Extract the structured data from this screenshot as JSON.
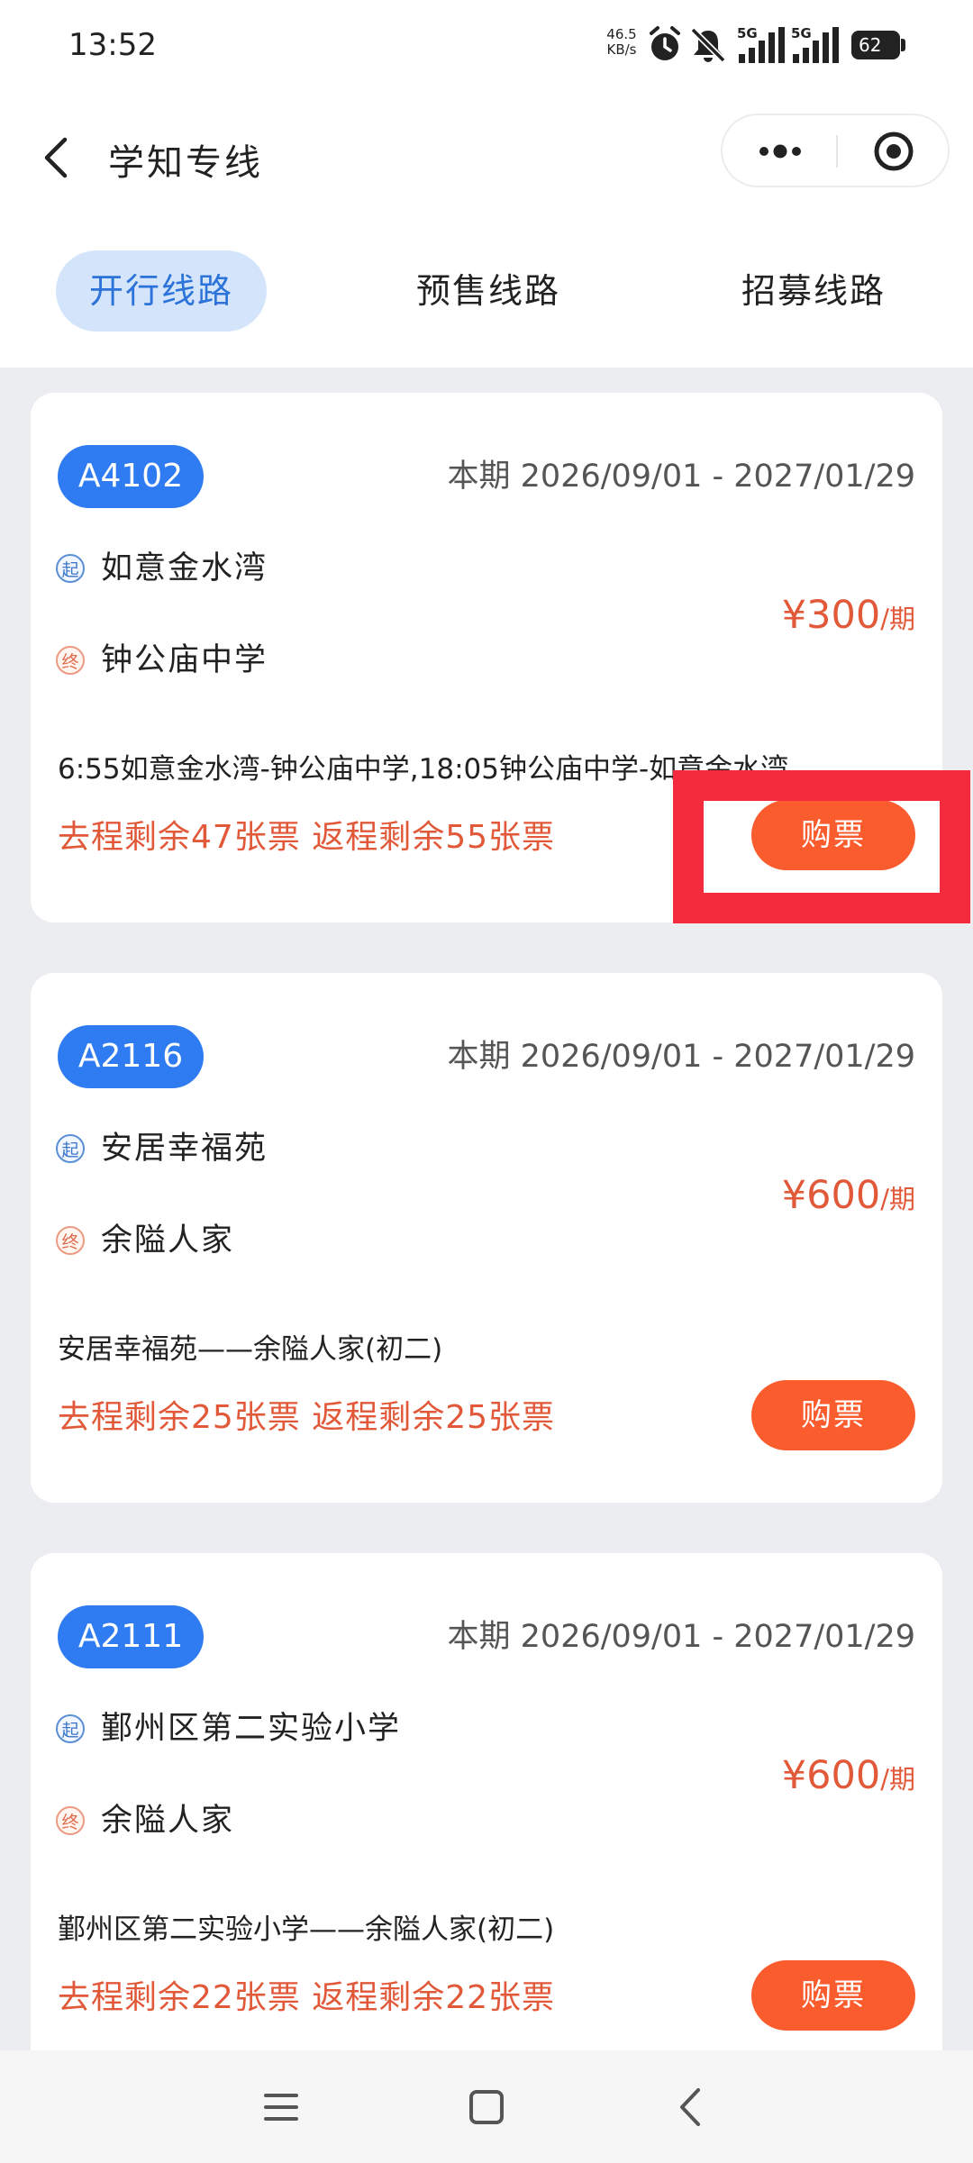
{
  "status_bar": {
    "time": "13:52",
    "net_speed_value": "46.5",
    "net_speed_unit": "KB/s",
    "signal_1_label": "5G",
    "signal_2_label": "5G",
    "battery": "62",
    "icons": [
      "alarm-icon",
      "mute-vibrate-icon",
      "signal-icon",
      "signal-icon",
      "battery-icon"
    ]
  },
  "nav": {
    "title": "学知专线",
    "icons": [
      "back-arrow-icon",
      "more-icon",
      "target-icon"
    ]
  },
  "tabs": [
    {
      "label": "开行线路",
      "active": true
    },
    {
      "label": "预售线路",
      "active": false
    },
    {
      "label": "招募线路",
      "active": false
    }
  ],
  "stop_tags": {
    "start": "起",
    "end": "终"
  },
  "routes": [
    {
      "code": "A4102",
      "period": "本期 2026/09/01 - 2027/01/29",
      "start": "如意金水湾",
      "end": "钟公庙中学",
      "price": "¥300",
      "unit": "/期",
      "desc": "6:55如意金水湾-钟公庙中学,18:05钟公庙中学-如意金水湾",
      "remaining": "去程剩余47张票 返程剩余55张票",
      "buy_label": "购票"
    },
    {
      "code": "A2116",
      "period": "本期 2026/09/01 - 2027/01/29",
      "start": "安居幸福苑",
      "end": "余隘人家",
      "price": "¥600",
      "unit": "/期",
      "desc": "安居幸福苑——余隘人家(初二)",
      "remaining": "去程剩余25张票 返程剩余25张票",
      "buy_label": "购票"
    },
    {
      "code": "A2111",
      "period": "本期 2026/09/01 - 2027/01/29",
      "start": "鄞州区第二实验小学",
      "end": "余隘人家",
      "price": "¥600",
      "unit": "/期",
      "desc": "鄞州区第二实验小学——余隘人家(初二)",
      "remaining": "去程剩余22张票 返程剩余22张票",
      "buy_label": "购票"
    }
  ],
  "colors": {
    "accent_blue": "#2f7cf2",
    "active_tab_bg": "#d4e5fb",
    "price_orange": "#e2593a",
    "buy_button": "#fb5c2d",
    "highlight_red": "#f22a3b"
  }
}
